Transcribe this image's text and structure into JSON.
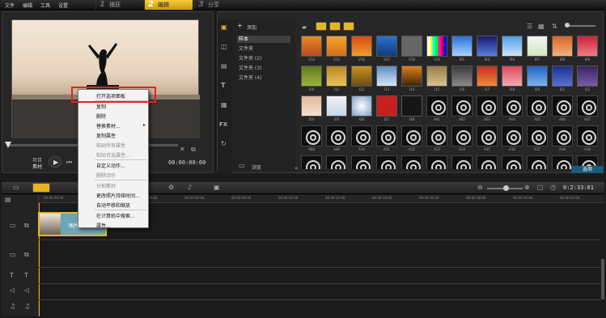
{
  "menu": [
    "文件",
    "编辑",
    "工具",
    "设置"
  ],
  "steps": [
    {
      "num": "1",
      "label": "捕获"
    },
    {
      "num": "2",
      "label": "编辑"
    },
    {
      "num": "3",
      "label": "分享"
    }
  ],
  "player": {
    "project_label": "项目",
    "clip_label": "素材",
    "timecode": "00:00:00:00"
  },
  "library": {
    "add_label": "添加",
    "browse_label": "浏览",
    "options_label": "选项",
    "folders": [
      "样本",
      "文件夹",
      "文件夹 (2)",
      "文件夹 (3)",
      "文件夹 (4)"
    ]
  },
  "thumbs_row1": [
    "V14",
    "V15",
    "V16",
    "V17",
    "V18",
    "V19",
    "I01",
    "I03",
    "I04",
    "I07",
    "I08",
    "I09"
  ],
  "thumbs_row2": [
    "I10",
    "I11",
    "I12",
    "I13",
    "I14",
    "I15",
    "I16",
    "I17",
    "I18",
    "I20",
    "I21",
    "I22"
  ],
  "thumbs_row3": [
    "I24",
    "I25",
    "I26",
    "I27",
    "I28",
    "A01",
    "A02",
    "A03",
    "A04",
    "A05",
    "A06",
    "A07"
  ],
  "thumbs_row4": [
    "A08",
    "A09",
    "A10",
    "A11",
    "A12",
    "A13",
    "A14",
    "A15",
    "A16",
    "A17",
    "A18",
    "A19"
  ],
  "timeline": {
    "timecode": "0:2:33:01",
    "ruler": [
      "00:00:00:00",
      "00:00:02:00",
      "00:00:04:00",
      "00:00:06:00",
      "00:00:08:00",
      "00:00:10:00",
      "00:00:12:00",
      "00:00:14:00",
      "00:00:16:00",
      "00:00:18:00",
      "00:00:20:00",
      "00:00:22:00"
    ],
    "clip_label": "图片"
  },
  "context_menu": {
    "items": [
      {
        "label": "打开选项面板",
        "enabled": true
      },
      {
        "label": "复制",
        "enabled": true
      },
      {
        "label": "删除",
        "enabled": true
      },
      {
        "label": "替换素材...",
        "enabled": true
      },
      {
        "label": "复制属性",
        "enabled": true
      },
      {
        "label": "粘贴所有属性",
        "enabled": false
      },
      {
        "label": "粘贴可选属性...",
        "enabled": false
      },
      {
        "label": "自定义动作...",
        "enabled": true
      },
      {
        "label": "删除动作",
        "enabled": false
      },
      {
        "label": "分割素材",
        "enabled": false
      },
      {
        "label": "更改照片持续时间...",
        "enabled": true
      },
      {
        "label": "自动平移和缩放",
        "enabled": true
      },
      {
        "label": "在计算机中搜索...",
        "enabled": true
      },
      {
        "label": "属性...",
        "enabled": true
      }
    ]
  },
  "colors": {
    "accent": "#e8b422",
    "highlight": "#e02424"
  }
}
